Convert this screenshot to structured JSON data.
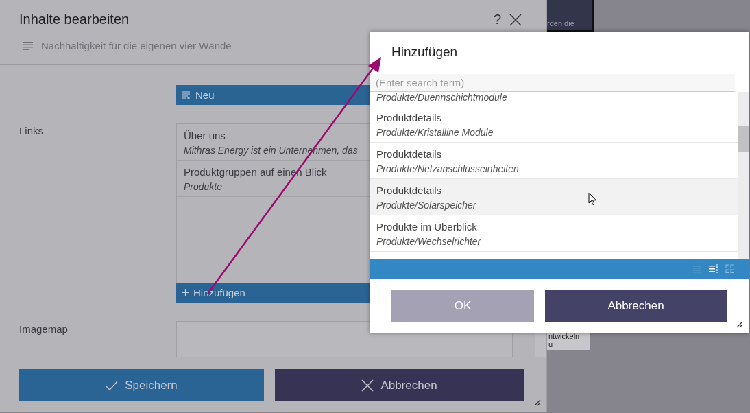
{
  "editor": {
    "title": "Inhalte bearbeiten",
    "subtitle": "Nachhaltigkeit für die eigenen vier Wände",
    "new_button": "Neu",
    "links_label": "Links",
    "links": [
      {
        "title": "Über uns",
        "description": "Mithras Energy ist ein Unternehmen, das"
      },
      {
        "title": "Produktgruppen auf einen Blick",
        "description": "Produkte"
      }
    ],
    "add_button": "Hinzufügen",
    "imagemap_label": "Imagemap",
    "save_button": "Speichern",
    "cancel_button": "Abbrechen",
    "help": "?"
  },
  "background": {
    "texts": [
      "rden die",
      "ntwickeln",
      "u"
    ]
  },
  "add_dialog": {
    "title": "Hinzufügen",
    "search": {
      "placeholder": "(Enter search term)"
    },
    "items": [
      {
        "path": "Produkte/Duennschichtmodule",
        "selected": false
      },
      {
        "title": "Produktdetails",
        "path": "Produkte/Kristalline Module",
        "selected": false
      },
      {
        "title": "Produktdetails",
        "path": "Produkte/Netzanschlusseinheiten",
        "selected": false
      },
      {
        "title": "Produktdetails",
        "path": "Produkte/Solarspeicher",
        "selected": true
      },
      {
        "title": "Produkte im Überblick",
        "path": "Produkte/Wechselrichter",
        "selected": false
      }
    ],
    "view_modes": [
      {
        "kind": "list",
        "selected": false
      },
      {
        "kind": "details",
        "selected": true
      },
      {
        "kind": "grid",
        "selected": false
      }
    ],
    "ok_button": "OK",
    "cancel_button": "Abbrechen"
  }
}
